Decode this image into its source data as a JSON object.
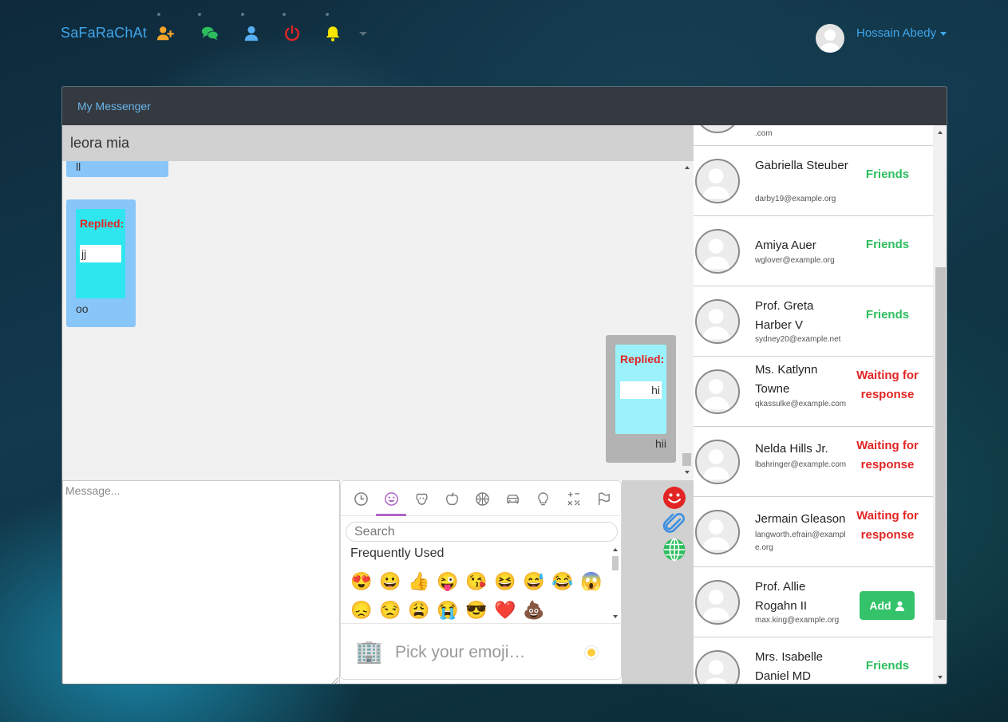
{
  "navbar": {
    "brand": "SaFaRaChAt",
    "icons": [
      "add-friend-icon",
      "chat-icon",
      "profile-icon",
      "power-icon",
      "bell-icon"
    ],
    "user_name": "Hossain Abedy"
  },
  "messenger": {
    "title": "My Messenger",
    "active_chat": "leora mia",
    "messages": [
      {
        "side": "left",
        "text": "ll"
      },
      {
        "side": "left",
        "replied_label": "Replied:",
        "replied_text": "jj",
        "text": "oo"
      },
      {
        "side": "right",
        "replied_label": "Replied:",
        "replied_text": "hi",
        "text": "hii"
      }
    ],
    "input_placeholder": "Message..."
  },
  "emoji_picker": {
    "categories": [
      "recent-icon",
      "smileys-icon",
      "animals-icon",
      "food-icon",
      "activity-icon",
      "travel-icon",
      "objects-icon",
      "symbols-icon",
      "flags-icon"
    ],
    "search_placeholder": "Search",
    "section_label": "Frequently Used",
    "emojis": [
      "😍",
      "😀",
      "👍",
      "😜",
      "😘",
      "😆",
      "😅",
      "😂",
      "😱",
      "😞",
      "😒",
      "😩",
      "😭",
      "😎",
      "❤️",
      "💩"
    ],
    "footer_emoji": "🏢",
    "footer_text": "Pick your emoji…"
  },
  "tools": [
    "emoji-icon",
    "attachment-icon",
    "globe-icon"
  ],
  "contacts": [
    {
      "name": "",
      "email": ".com",
      "status": ""
    },
    {
      "name": "Gabriella Steuber",
      "email": "darby19@example.org",
      "status": "Friends",
      "status_type": "friends"
    },
    {
      "name": "Amiya Auer",
      "email": "wglover@example.org",
      "status": "Friends",
      "status_type": "friends"
    },
    {
      "name": "Prof. Greta Harber V",
      "email": "sydney20@example.net",
      "status": "Friends",
      "status_type": "friends"
    },
    {
      "name": "Ms. Katlynn Towne",
      "email": "qkassulke@example.com",
      "status": "Waiting for response",
      "status_type": "waiting"
    },
    {
      "name": "Nelda Hills Jr.",
      "email": "lbahringer@example.com",
      "status": "Waiting for response",
      "status_type": "waiting"
    },
    {
      "name": "Jermain Gleason",
      "email": "langworth.efrain@example.org",
      "status": "Waiting for response",
      "status_type": "waiting"
    },
    {
      "name": "Prof. Allie Rogahn II",
      "email": "max.king@example.org",
      "status": "Add",
      "status_type": "add"
    },
    {
      "name": "Mrs. Isabelle Daniel MD",
      "email": "",
      "status": "Friends",
      "status_type": "friends"
    }
  ]
}
